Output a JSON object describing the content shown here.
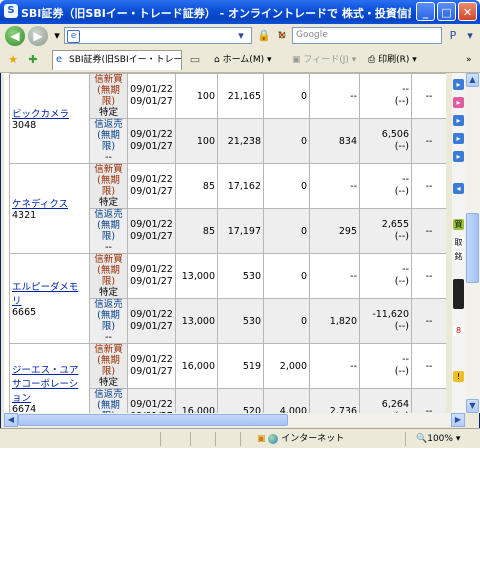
{
  "window": {
    "title": "SBI証券（旧SBIイー・トレード証券） - オンライントレードで 株式・投資信託・債券を － - Wi..."
  },
  "titlebar_buttons": {
    "minimize": "_",
    "maximize": "□",
    "close": "✕"
  },
  "navbar": {
    "back": "◀",
    "forward": "▶",
    "address_icon": "e",
    "search_placeholder": "Google",
    "search_go": "P"
  },
  "favbar": {
    "tab_label": "SBI証券(旧SBIイー・トレー...",
    "home": "ホーム(M)",
    "feed": "フィード(J)",
    "print": "印刷(R)"
  },
  "table": {
    "rows": [
      {
        "name": "ビックカメラ",
        "code": "3048",
        "type_line1": "信新買",
        "type_line2": "(無期限)",
        "type_line3": "特定",
        "date1": "09/01/22",
        "date2": "09/01/27",
        "qty": "100",
        "price": "21,165",
        "col7": "0",
        "col8": "--",
        "pl_top": "--",
        "pl_bottom": "(--)",
        "last": "--"
      },
      {
        "name": "",
        "code": "",
        "type_line1": "信返売",
        "type_line2": "(無期限)",
        "type_line3": "--",
        "date1": "09/01/22",
        "date2": "09/01/27",
        "qty": "100",
        "price": "21,238",
        "col7": "0",
        "col8": "834",
        "pl_top": "6,506",
        "pl_bottom": "(--)",
        "last": "--"
      },
      {
        "name": "ケネディクス",
        "code": "4321",
        "type_line1": "信新買",
        "type_line2": "(無期限)",
        "type_line3": "特定",
        "date1": "09/01/22",
        "date2": "09/01/27",
        "qty": "85",
        "price": "17,162",
        "col7": "0",
        "col8": "--",
        "pl_top": "--",
        "pl_bottom": "(--)",
        "last": "--"
      },
      {
        "name": "",
        "code": "",
        "type_line1": "信返売",
        "type_line2": "(無期限)",
        "type_line3": "--",
        "date1": "09/01/22",
        "date2": "09/01/27",
        "qty": "85",
        "price": "17,197",
        "col7": "0",
        "col8": "295",
        "pl_top": "2,655",
        "pl_bottom": "(--)",
        "last": "--"
      },
      {
        "name": "エルピーダメモリ",
        "code": "6665",
        "type_line1": "信新買",
        "type_line2": "(無期限)",
        "type_line3": "特定",
        "date1": "09/01/22",
        "date2": "09/01/27",
        "qty": "13,000",
        "price": "530",
        "col7": "0",
        "col8": "--",
        "pl_top": "--",
        "pl_bottom": "(--)",
        "last": "--"
      },
      {
        "name": "",
        "code": "",
        "type_line1": "信返売",
        "type_line2": "(無期限)",
        "type_line3": "--",
        "date1": "09/01/22",
        "date2": "09/01/27",
        "qty": "13,000",
        "price": "530",
        "col7": "0",
        "col8": "1,820",
        "pl_top": "-11,620",
        "pl_bottom": "(--)",
        "last": "--"
      },
      {
        "name": "ジーエス・ユアサコーポレーション",
        "code": "6674",
        "type_line1": "信新買",
        "type_line2": "(無期限)",
        "type_line3": "特定",
        "date1": "09/01/22",
        "date2": "09/01/27",
        "qty": "16,000",
        "price": "519",
        "col7": "2,000",
        "col8": "--",
        "pl_top": "--",
        "pl_bottom": "(--)",
        "last": "--"
      },
      {
        "name": "",
        "code": "",
        "type_line1": "信返売",
        "type_line2": "(無期限)",
        "type_line3": "--",
        "date1": "09/01/22",
        "date2": "09/01/27",
        "qty": "16,000",
        "price": "520",
        "col7": "4,000",
        "col8": "2,736",
        "pl_top": "6,264",
        "pl_bottom": "(--)",
        "last": "--"
      }
    ]
  },
  "right_strip": {
    "label1": "買",
    "label2": "取",
    "label3": "銘",
    "label4": "8"
  },
  "status": {
    "zone": "インターネット",
    "zoom": "100%"
  },
  "colors": {
    "titlebar": "#0a4fd6",
    "link": "#0022aa"
  }
}
